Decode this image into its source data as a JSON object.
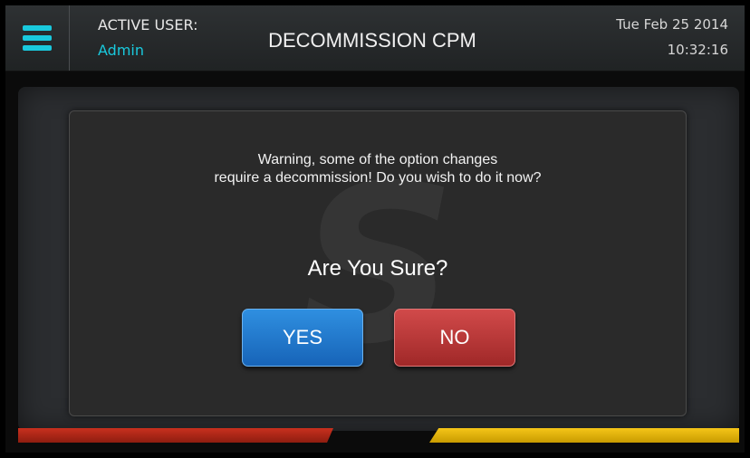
{
  "header": {
    "menu_icon": "hamburger-menu-icon",
    "user_label": "ACTIVE USER:",
    "user_name": "Admin",
    "title": "DECOMMISSION CPM",
    "date": "Tue Feb 25 2014",
    "time": "10:32:16"
  },
  "dialog": {
    "message_line1": "Warning, some of the option changes",
    "message_line2": "require a decommission! Do you wish to do it now?",
    "question": "Are You Sure?",
    "yes_label": "YES",
    "no_label": "NO"
  },
  "colors": {
    "accent": "#19c9dd",
    "yes_button": "#1f7bd0",
    "no_button": "#c03b3b",
    "bar_left": "#b8281a",
    "bar_right": "#f0be10"
  }
}
